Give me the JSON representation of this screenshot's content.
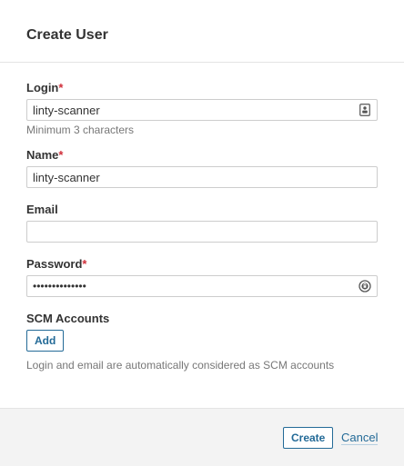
{
  "modal": {
    "title": "Create User"
  },
  "form": {
    "login": {
      "label": "Login",
      "required_mark": "*",
      "value": "linty-scanner",
      "hint": "Minimum 3 characters",
      "trailing_icon": "contact-card-icon"
    },
    "name": {
      "label": "Name",
      "required_mark": "*",
      "value": "linty-scanner"
    },
    "email": {
      "label": "Email",
      "value": ""
    },
    "password": {
      "label": "Password",
      "required_mark": "*",
      "value": "••••••••••••••",
      "trailing_icon": "password-manager-icon"
    },
    "scm": {
      "label": "SCM Accounts",
      "add_label": "Add",
      "hint": "Login and email are automatically considered as SCM accounts"
    }
  },
  "footer": {
    "create_label": "Create",
    "cancel_label": "Cancel"
  },
  "colors": {
    "primary": "#236a97",
    "required": "#d02f3a",
    "footer_bg": "#f3f3f3"
  }
}
